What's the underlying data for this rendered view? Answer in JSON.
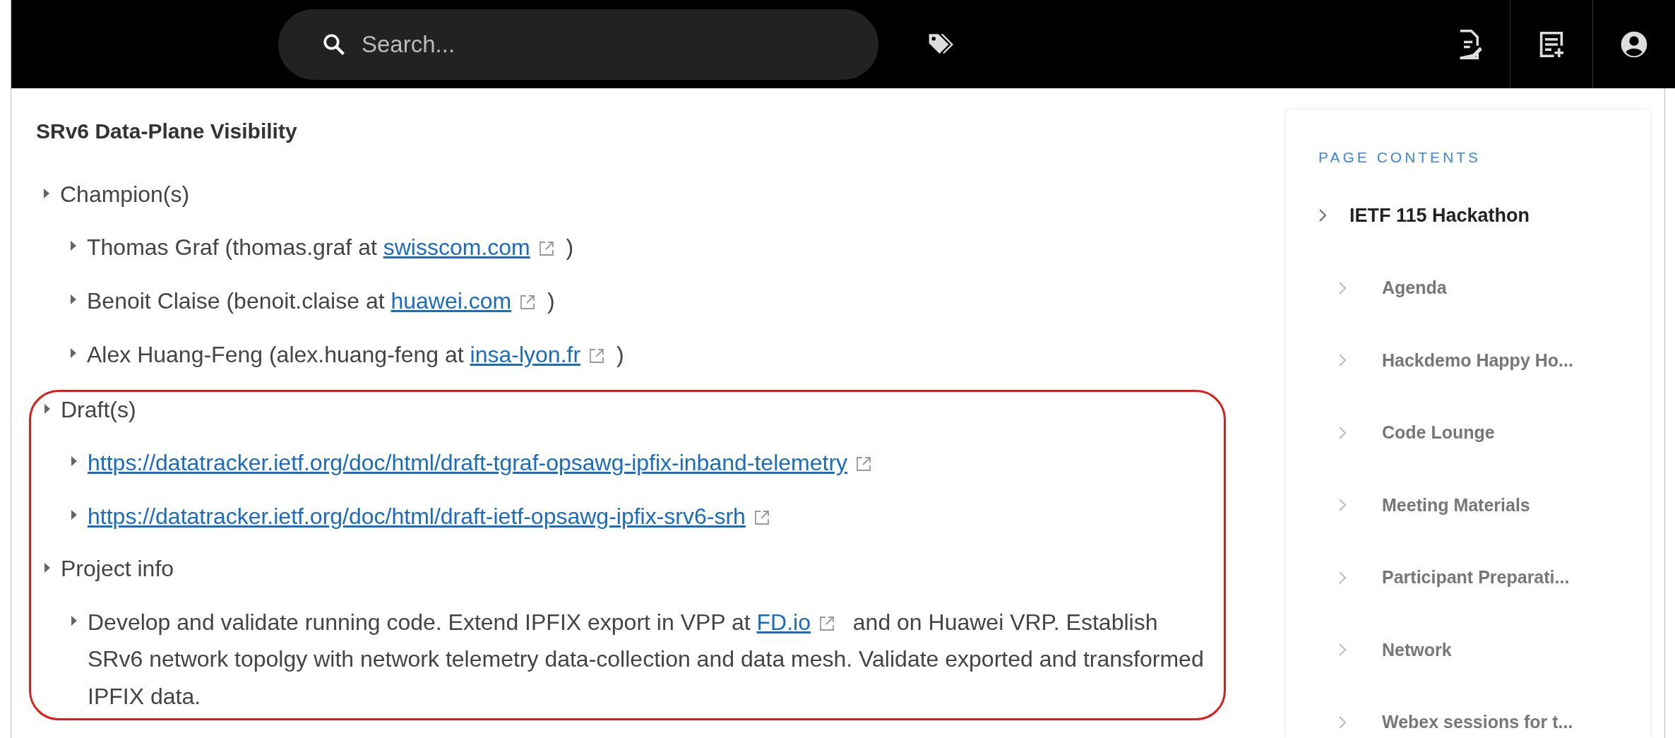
{
  "topbar": {
    "search": {
      "placeholder": "Search..."
    }
  },
  "article": {
    "title": "SRv6 Data-Plane Visibility",
    "sections": [
      {
        "label": "Champion(s)",
        "highlighted": false,
        "items": [
          {
            "parts": [
              {
                "kind": "text",
                "text": "Thomas Graf (thomas.graf at "
              },
              {
                "kind": "link",
                "text": "swisscom.com",
                "external": true
              },
              {
                "kind": "text",
                "text": " )"
              }
            ]
          },
          {
            "parts": [
              {
                "kind": "text",
                "text": "Benoit Claise (benoit.claise at "
              },
              {
                "kind": "link",
                "text": "huawei.com",
                "external": true
              },
              {
                "kind": "text",
                "text": " )"
              }
            ]
          },
          {
            "parts": [
              {
                "kind": "text",
                "text": "Alex Huang-Feng (alex.huang-feng at "
              },
              {
                "kind": "link",
                "text": "insa-lyon.fr",
                "external": true
              },
              {
                "kind": "text",
                "text": " )"
              }
            ]
          }
        ]
      },
      {
        "label": "Draft(s)",
        "highlighted": true,
        "items": [
          {
            "parts": [
              {
                "kind": "link",
                "text": "https://datatracker.ietf.org/doc/html/draft-tgraf-opsawg-ipfix-inband-telemetry",
                "external": true
              }
            ]
          },
          {
            "parts": [
              {
                "kind": "link",
                "text": "https://datatracker.ietf.org/doc/html/draft-ietf-opsawg-ipfix-srv6-srh",
                "external": true
              }
            ]
          }
        ]
      },
      {
        "label": "Project info",
        "highlighted": true,
        "items": [
          {
            "parts": [
              {
                "kind": "text",
                "text": "Develop and validate running code. Extend IPFIX export in VPP at "
              },
              {
                "kind": "link",
                "text": "FD.io",
                "external": true
              },
              {
                "kind": "text",
                "text": "  and on Huawei VRP. Establish SRv6 network topolgy with network telemetry data-collection and data mesh. Validate exported and transformed IPFIX data."
              }
            ]
          }
        ]
      }
    ]
  },
  "toc": {
    "heading": "PAGE CONTENTS",
    "items": [
      {
        "label": "IETF 115 Hackathon",
        "children": [
          {
            "label": "Agenda"
          },
          {
            "label": "Hackdemo Happy Ho..."
          },
          {
            "label": "Code Lounge"
          },
          {
            "label": "Meeting Materials"
          },
          {
            "label": "Participant Preparati..."
          },
          {
            "label": "Network"
          },
          {
            "label": "Webex sessions for t..."
          }
        ]
      }
    ]
  }
}
